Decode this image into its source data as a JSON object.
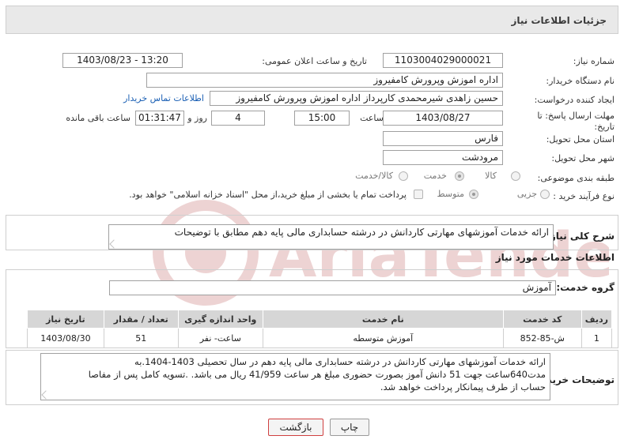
{
  "header": {
    "title": "جزئیات اطلاعات نیاز"
  },
  "form": {
    "need_number": {
      "label": "شماره نیاز:",
      "value": "1103004029000021"
    },
    "announce_datetime": {
      "label": "تاریخ و ساعت اعلان عمومی:",
      "value": "1403/08/23 - 13:20"
    },
    "buyer_org": {
      "label": "نام دستگاه خریدار:",
      "value": "اداره اموزش وپرورش کامفیروز"
    },
    "requester": {
      "label": "ایجاد کننده درخواست:",
      "value": "حسین زاهدی شیرمحمدی کارپرداز اداره اموزش وپرورش کامفیروز",
      "contact_link": "اطلاعات تماس خریدار"
    },
    "deadline": {
      "label_line1": "مهلت ارسال پاسخ: تا",
      "label_line2": "تاریخ:",
      "date": "1403/08/27",
      "time_label": "ساعت",
      "time": "15:00",
      "days": "4",
      "days_label": "روز و",
      "remaining": "01:31:47",
      "remaining_label": "ساعت باقی مانده"
    },
    "province": {
      "label": "استان محل تحویل:",
      "value": "فارس"
    },
    "city": {
      "label": "شهر محل تحویل:",
      "value": "مرودشت"
    },
    "category": {
      "label": "طبقه بندی موضوعی:",
      "options": [
        "کالا",
        "خدمت",
        "کالا/خدمت"
      ],
      "selected": "خدمت"
    },
    "purchase_type": {
      "label": "نوع فرآیند خرید :",
      "options": [
        "جزیی",
        "متوسط"
      ],
      "selected": "متوسط",
      "treasury_note": "پرداخت تمام یا بخشی از مبلغ خرید،از محل \"اسناد خزانه اسلامی\" خواهد بود."
    }
  },
  "summary": {
    "label": "شرح کلی نیاز:",
    "value": "ارائه خدمات آموزشهای مهارتی کاردانش در درشته حسابداری مالی پایه دهم مطابق با توضیحات"
  },
  "services": {
    "section_title": "اطلاعات خدمات مورد نیاز",
    "group_label": "گروه خدمت:",
    "group_value": "آموزش",
    "columns": [
      "ردیف",
      "کد خدمت",
      "نام خدمت",
      "واحد اندازه گیری",
      "تعداد / مقدار",
      "تاریخ نیاز"
    ],
    "rows": [
      {
        "row": "1",
        "code": "ش-85-852",
        "name": "آموزش متوسطه",
        "unit": "ساعت- نفر",
        "qty": "51",
        "date": "1403/08/30"
      }
    ]
  },
  "buyer_notes": {
    "label": "توضیحات خریدار:",
    "lines": [
      "ارائه خدمات آموزشهای مهارتی کاردانش در درشته حسابداری مالی پایه دهم  در سال تحصیلی 1403-1404.به",
      "مدت640ساعت جهت 51 دانش آموز بصورت حضوری مبلغ هر ساعت 41/959 ریال می باشد. .تسویه کامل پس از مفاصا",
      "حساب از طرف پیمانکار پرداخت خواهد شد."
    ]
  },
  "buttons": {
    "print": "چاپ",
    "back": "بازگشت"
  },
  "watermark": {
    "text": "AriaTender.neT"
  },
  "colors": {
    "link": "#1a5fb4",
    "back_button_border": "#d04040",
    "watermark": "#d9a0a0"
  }
}
